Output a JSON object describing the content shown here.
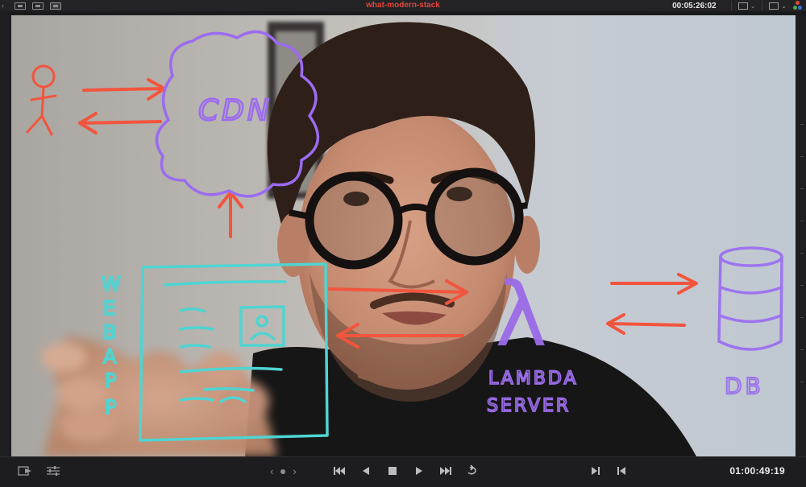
{
  "window": {
    "clip_title": "what-modern-stack",
    "source_timecode": "00:05:26:02",
    "record_timecode": "01:00:49:19"
  },
  "toolbar_left": {
    "icons": [
      "chevron-left-icon",
      "single-viewer-icon",
      "dual-viewer-icon",
      "cinema-viewer-icon"
    ]
  },
  "toolbar_right": {
    "icons": [
      "viewer-mode-icon",
      "view-options-icon",
      "color-wheel-icon"
    ]
  },
  "drawing": {
    "cdn_label": "CDN",
    "webapp_label": [
      "W",
      "E",
      "B",
      "A",
      "P",
      "P"
    ],
    "lambda_symbol": "λ",
    "lambda_label_line1": "LAMBDA",
    "lambda_label_line2": "SERVER",
    "db_label": "DB",
    "colors": {
      "arrows": "#f2553e",
      "user": "#f2553e",
      "cdn": "#9b6bf0",
      "webapp": "#4fd4d2",
      "lambda": "#9a6be8",
      "db": "#9d74ee"
    }
  },
  "playback": {
    "prev_clip_glyph": "‹",
    "next_clip_glyph": "›",
    "buttons": [
      "first-frame-icon",
      "play-reverse-icon",
      "stop-icon",
      "play-icon",
      "last-frame-icon",
      "loop-icon"
    ],
    "mark_buttons": [
      "mark-in-icon",
      "mark-out-icon"
    ]
  }
}
